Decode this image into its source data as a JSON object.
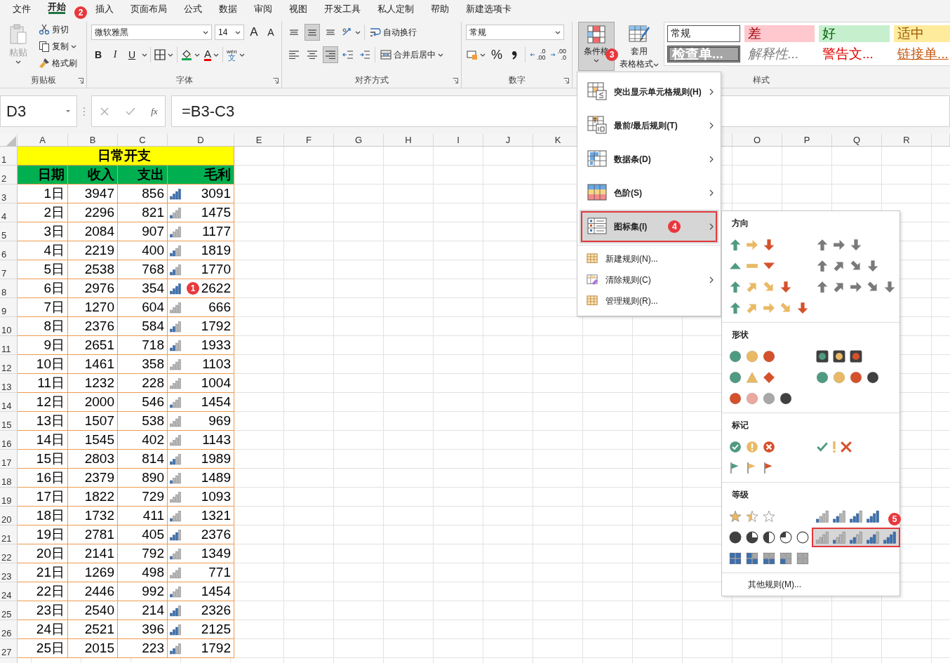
{
  "tabs": [
    {
      "label": "文件",
      "selected": false
    },
    {
      "label": "开始",
      "selected": true,
      "badge": "2"
    },
    {
      "label": "插入",
      "selected": false
    },
    {
      "label": "页面布局",
      "selected": false
    },
    {
      "label": "公式",
      "selected": false
    },
    {
      "label": "数据",
      "selected": false
    },
    {
      "label": "审阅",
      "selected": false
    },
    {
      "label": "视图",
      "selected": false
    },
    {
      "label": "开发工具",
      "selected": false
    },
    {
      "label": "私人定制",
      "selected": false
    },
    {
      "label": "帮助",
      "selected": false
    },
    {
      "label": "新建选项卡",
      "selected": false
    }
  ],
  "ribbon": {
    "clipboard": {
      "title": "剪贴板",
      "paste": "粘贴",
      "paste_disabled": true,
      "cut": "剪切",
      "copy": "复制",
      "format_painter": "格式刷"
    },
    "font": {
      "title": "字体",
      "name": "微软雅黑",
      "size": "14",
      "grow": "A",
      "shrink": "A",
      "bold": "B",
      "italic": "I",
      "underline": "U",
      "color_letter": "A",
      "phonetic_top": "wén",
      "phonetic_bottom": "文"
    },
    "alignment": {
      "title": "对齐方式",
      "wrap": "自动换行",
      "merge": "合并后居中",
      "vertical": [
        {
          "selected": false
        },
        {
          "selected": true
        },
        {
          "selected": false
        }
      ],
      "horizontal": [
        {
          "selected": false
        },
        {
          "selected": false
        },
        {
          "selected": true
        }
      ]
    },
    "number": {
      "title": "数字",
      "format": "常规",
      "percent": "%",
      "decimals": [
        {
          "top": ".0",
          "bottom": ".00"
        },
        {
          "top": ".00",
          "bottom": ".0"
        }
      ]
    },
    "styles": {
      "title": "样式",
      "conditional": {
        "label": "条件格",
        "expanded": true,
        "badge": "3"
      },
      "table_format": [
        "套用",
        "表格格式"
      ],
      "gallery": [
        {
          "label": "常规",
          "kind": "normal"
        },
        {
          "label": "差",
          "kind": "bad"
        },
        {
          "label": "好",
          "kind": "good"
        },
        {
          "label": "适中",
          "kind": "neutral"
        },
        {
          "label": "检查单...",
          "kind": "check"
        },
        {
          "label": "解释性...",
          "kind": "explanatory"
        },
        {
          "label": "警告文...",
          "kind": "warning"
        },
        {
          "label": "链接单...",
          "kind": "hyperlink"
        }
      ]
    }
  },
  "formula_bar": {
    "name_box": "D3",
    "fx": "fx",
    "formula": "=B3-C3"
  },
  "sheet": {
    "columns_left": [
      "A",
      "B",
      "C",
      "D",
      "E",
      "F",
      "G",
      "H",
      "I",
      "J",
      "K"
    ],
    "columns_right": [
      "O",
      "P",
      "Q",
      "R"
    ],
    "title_row": {
      "n": "1",
      "title": "日常开支"
    },
    "header_row": {
      "n": "2",
      "cells": [
        "日期",
        "收入",
        "支出",
        "毛利"
      ]
    },
    "rows": [
      {
        "n": "3",
        "date": "1日",
        "income": "3947",
        "expense": "856",
        "profit": "3091",
        "level": 1
      },
      {
        "n": "4",
        "date": "2日",
        "income": "2296",
        "expense": "821",
        "profit": "1475",
        "level": 0.25
      },
      {
        "n": "5",
        "date": "3日",
        "income": "2084",
        "expense": "907",
        "profit": "1177",
        "level": 0.25
      },
      {
        "n": "6",
        "date": "4日",
        "income": "2219",
        "expense": "400",
        "profit": "1819",
        "level": 0.5
      },
      {
        "n": "7",
        "date": "5日",
        "income": "2538",
        "expense": "768",
        "profit": "1770",
        "level": 0.5
      },
      {
        "n": "8",
        "date": "6日",
        "income": "2976",
        "expense": "354",
        "profit": "2622",
        "level": 1,
        "badge": "1"
      },
      {
        "n": "9",
        "date": "7日",
        "income": "1270",
        "expense": "604",
        "profit": "666",
        "level": 0
      },
      {
        "n": "10",
        "date": "8日",
        "income": "2376",
        "expense": "584",
        "profit": "1792",
        "level": 0.5
      },
      {
        "n": "11",
        "date": "9日",
        "income": "2651",
        "expense": "718",
        "profit": "1933",
        "level": 0.5
      },
      {
        "n": "12",
        "date": "10日",
        "income": "1461",
        "expense": "358",
        "profit": "1103",
        "level": 0
      },
      {
        "n": "13",
        "date": "11日",
        "income": "1232",
        "expense": "228",
        "profit": "1004",
        "level": 0
      },
      {
        "n": "14",
        "date": "12日",
        "income": "2000",
        "expense": "546",
        "profit": "1454",
        "level": 0.25
      },
      {
        "n": "15",
        "date": "13日",
        "income": "1507",
        "expense": "538",
        "profit": "969",
        "level": 0
      },
      {
        "n": "16",
        "date": "14日",
        "income": "1545",
        "expense": "402",
        "profit": "1143",
        "level": 0
      },
      {
        "n": "17",
        "date": "15日",
        "income": "2803",
        "expense": "814",
        "profit": "1989",
        "level": 0.5
      },
      {
        "n": "18",
        "date": "16日",
        "income": "2379",
        "expense": "890",
        "profit": "1489",
        "level": 0.25
      },
      {
        "n": "19",
        "date": "17日",
        "income": "1822",
        "expense": "729",
        "profit": "1093",
        "level": 0
      },
      {
        "n": "20",
        "date": "18日",
        "income": "1732",
        "expense": "411",
        "profit": "1321",
        "level": 0.25
      },
      {
        "n": "21",
        "date": "19日",
        "income": "2781",
        "expense": "405",
        "profit": "2376",
        "level": 0.75
      },
      {
        "n": "22",
        "date": "20日",
        "income": "2141",
        "expense": "792",
        "profit": "1349",
        "level": 0.25
      },
      {
        "n": "23",
        "date": "21日",
        "income": "1269",
        "expense": "498",
        "profit": "771",
        "level": 0
      },
      {
        "n": "24",
        "date": "22日",
        "income": "2446",
        "expense": "992",
        "profit": "1454",
        "level": 0.25
      },
      {
        "n": "25",
        "date": "23日",
        "income": "2540",
        "expense": "214",
        "profit": "2326",
        "level": 0.75
      },
      {
        "n": "26",
        "date": "24日",
        "income": "2521",
        "expense": "396",
        "profit": "2125",
        "level": 0.75
      },
      {
        "n": "27",
        "date": "25日",
        "income": "2015",
        "expense": "223",
        "profit": "1792",
        "level": 0.5
      }
    ]
  },
  "cf_menu": {
    "main": [
      {
        "label": "突出显示单元格规则(H)",
        "kind": "highlight",
        "open": false,
        "highlighted": false
      },
      {
        "label": "最前/最后规则(T)",
        "kind": "topbottom",
        "open": false,
        "highlighted": false
      },
      {
        "label": "数据条(D)",
        "kind": "databar",
        "open": false,
        "highlighted": false
      },
      {
        "label": "色阶(S)",
        "kind": "colorscale",
        "open": false,
        "highlighted": false
      },
      {
        "label": "图标集(I)",
        "kind": "iconset",
        "open": true,
        "highlighted": true,
        "badge": "4"
      }
    ],
    "rules": [
      {
        "label": "新建规则(N)...",
        "kind": "new",
        "submenu": false
      },
      {
        "label": "清除规则(C)",
        "kind": "clear",
        "submenu": true
      },
      {
        "label": "管理规则(R)...",
        "kind": "manage",
        "submenu": false
      }
    ]
  },
  "icon_sets": {
    "sections": [
      {
        "title": "方向",
        "sets": [
          {
            "kind": "arrows3",
            "highlighted": false
          },
          {
            "kind": "arrows3gray",
            "highlighted": false
          },
          {
            "kind": "triangles3",
            "highlighted": false
          },
          {
            "kind": "arrows4gray",
            "highlighted": false
          },
          {
            "kind": "arrows4",
            "highlighted": false
          },
          {
            "kind": "arrows5gray",
            "highlighted": false
          },
          {
            "kind": "arrows5",
            "highlighted": false
          }
        ]
      },
      {
        "title": "形状",
        "sets": [
          {
            "kind": "traffic3",
            "highlighted": false
          },
          {
            "kind": "traffic3rim",
            "highlighted": false
          },
          {
            "kind": "signs3",
            "highlighted": false
          },
          {
            "kind": "traffic4",
            "highlighted": false
          },
          {
            "kind": "redblack4",
            "highlighted": false
          }
        ]
      },
      {
        "title": "标记",
        "sets": [
          {
            "kind": "symbols3circled",
            "highlighted": false
          },
          {
            "kind": "symbols3",
            "highlighted": false
          },
          {
            "kind": "flags3",
            "highlighted": false
          }
        ]
      },
      {
        "title": "等级",
        "sets": [
          {
            "kind": "stars3",
            "highlighted": false
          },
          {
            "kind": "bars4",
            "highlighted": false
          },
          {
            "kind": "quarters5",
            "highlighted": false
          },
          {
            "kind": "bars5",
            "highlighted": true,
            "badge": "5"
          },
          {
            "kind": "boxes5",
            "highlighted": false
          }
        ]
      }
    ],
    "more": "其他规则(M)..."
  }
}
